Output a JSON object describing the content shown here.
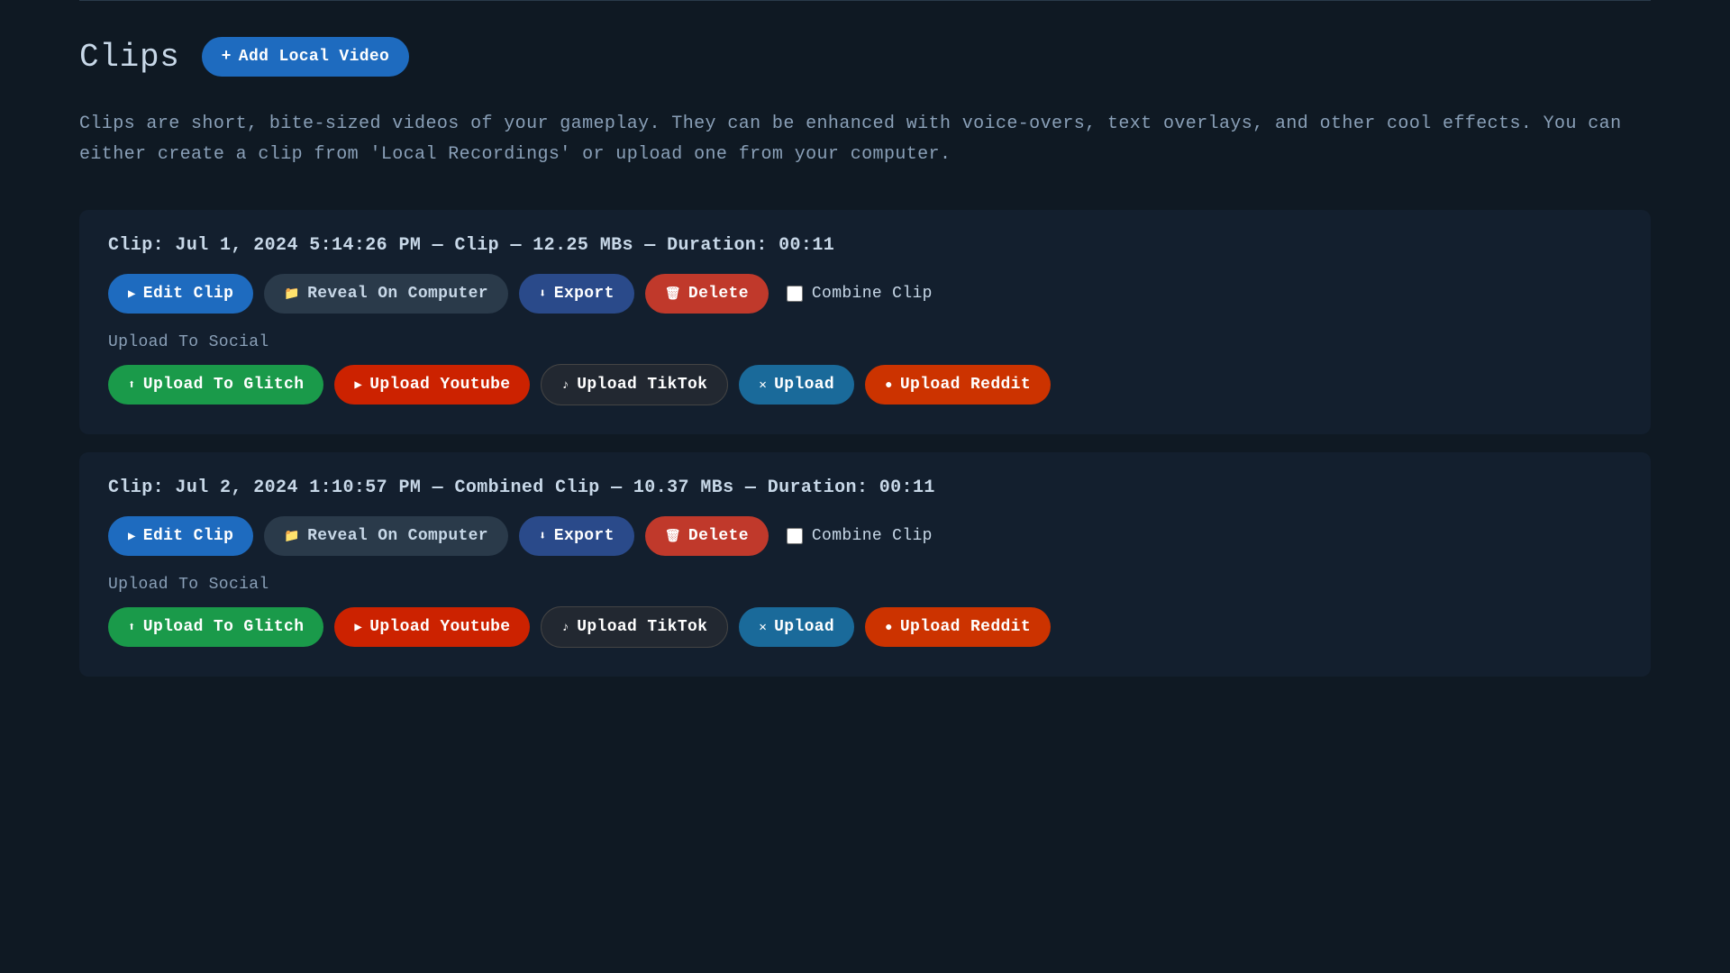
{
  "page": {
    "title": "Clips",
    "add_button_label": "Add Local Video",
    "description": "Clips are short, bite-sized videos of your gameplay. They can be enhanced with voice-overs, text overlays, and other cool effects. You can either create a clip from 'Local Recordings' or upload one from your computer."
  },
  "clips": [
    {
      "id": "clip-1",
      "info": "Clip: Jul 1, 2024 5:14:26 PM — Clip — 12.25 MBs — Duration: 00:11",
      "clip_label": "Clip:",
      "clip_detail": "Jul 1, 2024 5:14:26 PM — Clip — 12.25 MBs — Duration: 00:11",
      "combine_checked": false,
      "upload_to_social_label": "Upload To Social",
      "buttons": {
        "edit": "Edit Clip",
        "reveal": "Reveal On Computer",
        "export": "Export",
        "delete": "Delete",
        "combine": "Combine Clip",
        "glitch": "Upload To Glitch",
        "youtube": "Upload Youtube",
        "tiktok": "Upload TikTok",
        "x": "Upload",
        "reddit": "Upload Reddit"
      }
    },
    {
      "id": "clip-2",
      "info": "Clip: Jul 2, 2024 1:10:57 PM — Combined Clip — 10.37 MBs — Duration: 00:11",
      "clip_label": "Clip:",
      "clip_detail": "Jul 2, 2024 1:10:57 PM — Combined Clip — 10.37 MBs — Duration: 00:11",
      "combine_checked": false,
      "upload_to_social_label": "Upload To Social",
      "buttons": {
        "edit": "Edit Clip",
        "reveal": "Reveal On Computer",
        "export": "Export",
        "delete": "Delete",
        "combine": "Combine Clip",
        "glitch": "Upload To Glitch",
        "youtube": "Upload Youtube",
        "tiktok": "Upload TikTok",
        "x": "Upload",
        "reddit": "Upload Reddit"
      }
    }
  ]
}
